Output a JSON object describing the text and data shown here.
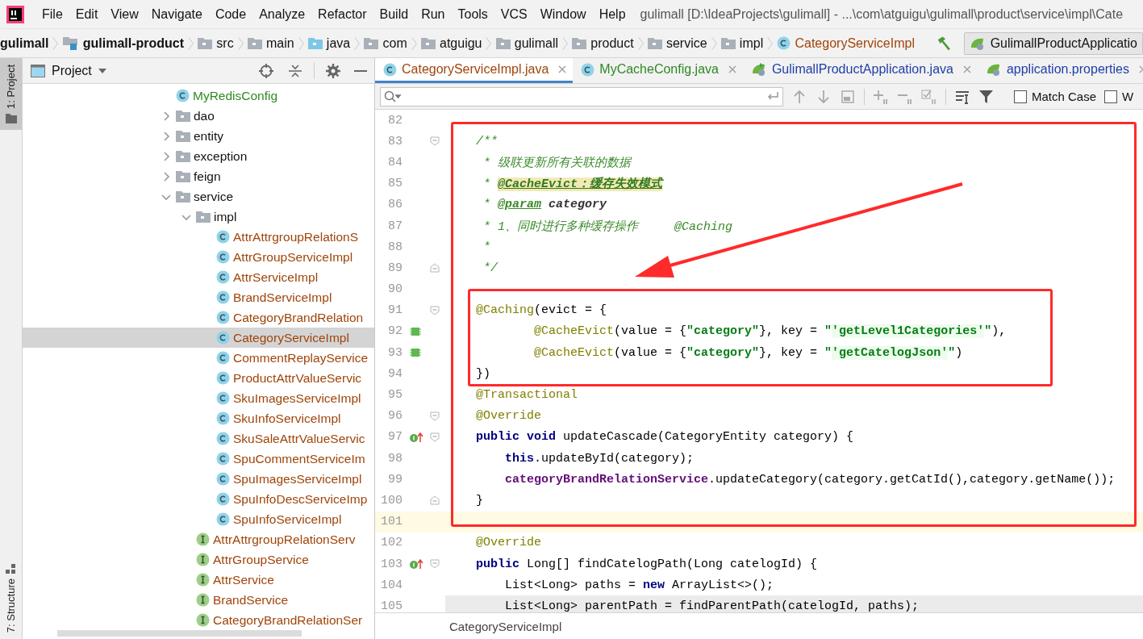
{
  "menu": [
    "File",
    "Edit",
    "View",
    "Navigate",
    "Code",
    "Analyze",
    "Refactor",
    "Build",
    "Run",
    "Tools",
    "VCS",
    "Window",
    "Help"
  ],
  "window": {
    "title": "gulimall [D:\\IdeaProjects\\gulimall] - ...\\com\\atguigu\\gulimall\\product\\service\\impl\\Cate"
  },
  "breadcrumbs": [
    {
      "label": "gulimall",
      "kind": "project"
    },
    {
      "label": "gulimall-product",
      "kind": "module"
    },
    {
      "label": "src",
      "kind": "folder"
    },
    {
      "label": "main",
      "kind": "folder"
    },
    {
      "label": "java",
      "kind": "source"
    },
    {
      "label": "com",
      "kind": "package"
    },
    {
      "label": "atguigu",
      "kind": "package"
    },
    {
      "label": "gulimall",
      "kind": "package"
    },
    {
      "label": "product",
      "kind": "package"
    },
    {
      "label": "service",
      "kind": "package"
    },
    {
      "label": "impl",
      "kind": "package"
    },
    {
      "label": "CategoryServiceImpl",
      "kind": "class"
    }
  ],
  "run_config": {
    "label": "GulimallProductApplicatio"
  },
  "tool_strip": [
    {
      "label": "1: Project",
      "selected": true,
      "kind": "project"
    },
    {
      "label": "7: Structure",
      "selected": false,
      "kind": "structure"
    }
  ],
  "project_panel": {
    "title": "Project",
    "tree": [
      {
        "label": "MyRedisConfig",
        "kind": "class",
        "color": "#2f8a22",
        "selected": false
      },
      {
        "label": "dao",
        "kind": "package",
        "expanded": false,
        "selected": false
      },
      {
        "label": "entity",
        "kind": "package",
        "expanded": false,
        "selected": false
      },
      {
        "label": "exception",
        "kind": "package",
        "expanded": false,
        "selected": false
      },
      {
        "label": "feign",
        "kind": "package",
        "expanded": false,
        "selected": false
      },
      {
        "label": "service",
        "kind": "package",
        "expanded": true,
        "selected": false,
        "children": [
          {
            "label": "impl",
            "kind": "package",
            "expanded": true,
            "selected": false,
            "children": [
              {
                "label": "AttrAttrgroupRelationS",
                "kind": "class",
                "color": "#a0450a",
                "selected": false
              },
              {
                "label": "AttrGroupServiceImpl",
                "kind": "class",
                "color": "#a0450a",
                "selected": false
              },
              {
                "label": "AttrServiceImpl",
                "kind": "class",
                "color": "#a0450a",
                "selected": false
              },
              {
                "label": "BrandServiceImpl",
                "kind": "class",
                "color": "#a0450a",
                "selected": false
              },
              {
                "label": "CategoryBrandRelation",
                "kind": "class",
                "color": "#a0450a",
                "selected": false
              },
              {
                "label": "CategoryServiceImpl",
                "kind": "class",
                "color": "#a0450a",
                "selected": true
              },
              {
                "label": "CommentReplayService",
                "kind": "class",
                "color": "#a0450a",
                "selected": false
              },
              {
                "label": "ProductAttrValueServic",
                "kind": "class",
                "color": "#a0450a",
                "selected": false
              },
              {
                "label": "SkuImagesServiceImpl",
                "kind": "class",
                "color": "#a0450a",
                "selected": false
              },
              {
                "label": "SkuInfoServiceImpl",
                "kind": "class",
                "color": "#a0450a",
                "selected": false
              },
              {
                "label": "SkuSaleAttrValueServic",
                "kind": "class",
                "color": "#a0450a",
                "selected": false
              },
              {
                "label": "SpuCommentServiceIm",
                "kind": "class",
                "color": "#a0450a",
                "selected": false
              },
              {
                "label": "SpuImagesServiceImpl",
                "kind": "class",
                "color": "#a0450a",
                "selected": false
              },
              {
                "label": "SpuInfoDescServiceImp",
                "kind": "class",
                "color": "#a0450a",
                "selected": false
              },
              {
                "label": "SpuInfoServiceImpl",
                "kind": "class",
                "color": "#a0450a",
                "selected": false
              }
            ]
          },
          {
            "label": "AttrAttrgroupRelationServ",
            "kind": "interface",
            "color": "#a0450a",
            "selected": false
          },
          {
            "label": "AttrGroupService",
            "kind": "interface",
            "color": "#a0450a",
            "selected": false
          },
          {
            "label": "AttrService",
            "kind": "interface",
            "color": "#a0450a",
            "selected": false
          },
          {
            "label": "BrandService",
            "kind": "interface",
            "color": "#a0450a",
            "selected": false
          },
          {
            "label": "CategoryBrandRelationSer",
            "kind": "interface",
            "color": "#a0450a",
            "selected": false
          }
        ]
      }
    ]
  },
  "tabs": [
    {
      "label": "CategoryServiceImpl.java",
      "kind": "class",
      "color": "#a0450a",
      "selected": true
    },
    {
      "label": "MyCacheConfig.java",
      "kind": "class",
      "color": "#2f8a22",
      "selected": false
    },
    {
      "label": "GulimallProductApplication.java",
      "kind": "app",
      "color": "#1f3fa8",
      "selected": false
    },
    {
      "label": "application.properties",
      "kind": "properties",
      "color": "#1f3fa8",
      "selected": false
    }
  ],
  "find_bar": {
    "options": [
      {
        "label": "Match Case",
        "checked": false
      },
      {
        "label": "W",
        "checked": false
      }
    ]
  },
  "code": {
    "lines": [
      {
        "number": "82"
      },
      {
        "number": "83",
        "fold_start": true,
        "tokens": [
          {
            "text": "    /**",
            "kind": "comment"
          }
        ]
      },
      {
        "number": "84",
        "tokens": [
          {
            "text": "     * 级联更新所有关联的数据",
            "kind": "comment"
          }
        ]
      },
      {
        "number": "85",
        "tokens": [
          {
            "text": "     * ",
            "kind": "comment"
          },
          {
            "text": "@CacheEvict：缓存失效模式",
            "kind": "doctag-marked"
          }
        ]
      },
      {
        "number": "86",
        "tokens": [
          {
            "text": "     * ",
            "kind": "comment"
          },
          {
            "text": "@param",
            "kind": "doctag"
          },
          {
            "text": " category",
            "kind": "param"
          }
        ]
      },
      {
        "number": "87",
        "tokens": [
          {
            "text": "     * 1、同时进行多种缓存操作     @Caching",
            "kind": "comment"
          }
        ]
      },
      {
        "number": "88",
        "tokens": [
          {
            "text": "     *",
            "kind": "comment"
          }
        ]
      },
      {
        "number": "89",
        "fold_end": true,
        "tokens": [
          {
            "text": "     */",
            "kind": "comment"
          }
        ]
      },
      {
        "number": "90"
      },
      {
        "number": "91",
        "fold_start": true,
        "tokens": [
          {
            "text": "    @Caching",
            "kind": "annotation"
          },
          {
            "text": "(evict = {",
            "kind": "plain"
          }
        ]
      },
      {
        "number": "92",
        "bean": true,
        "tokens": [
          {
            "text": "            @CacheEvict",
            "kind": "annotation"
          },
          {
            "text": "(value = {",
            "kind": "plain"
          },
          {
            "text": "\"category\"",
            "kind": "string"
          },
          {
            "text": "}, key = ",
            "kind": "plain"
          },
          {
            "text": "\"",
            "kind": "string"
          },
          {
            "text": "'getLevel1Categories'",
            "kind": "injected"
          },
          {
            "text": "\"",
            "kind": "string"
          },
          {
            "text": "),",
            "kind": "plain"
          }
        ]
      },
      {
        "number": "93",
        "bean": true,
        "tokens": [
          {
            "text": "            @CacheEvict",
            "kind": "annotation"
          },
          {
            "text": "(value = {",
            "kind": "plain"
          },
          {
            "text": "\"category\"",
            "kind": "string"
          },
          {
            "text": "}, key = ",
            "kind": "plain"
          },
          {
            "text": "\"",
            "kind": "string"
          },
          {
            "text": "'getCatelogJson'",
            "kind": "injected"
          },
          {
            "text": "\"",
            "kind": "string"
          },
          {
            "text": ")",
            "kind": "plain"
          }
        ]
      },
      {
        "number": "94",
        "tokens": [
          {
            "text": "    })",
            "kind": "plain"
          }
        ]
      },
      {
        "number": "95",
        "tokens": [
          {
            "text": "    @Transactional",
            "kind": "annotation"
          }
        ]
      },
      {
        "number": "96",
        "fold_start": true,
        "tokens": [
          {
            "text": "    @Override",
            "kind": "annotation"
          }
        ]
      },
      {
        "number": "97",
        "implements": true,
        "fold_start": true,
        "tokens": [
          {
            "text": "    public",
            "kind": "keyword"
          },
          {
            "text": " void",
            "kind": "keyword"
          },
          {
            "text": " updateCascade(CategoryEntity category) {",
            "kind": "plain"
          }
        ]
      },
      {
        "number": "98",
        "tokens": [
          {
            "text": "        this",
            "kind": "keyword"
          },
          {
            "text": ".updateById(category);",
            "kind": "plain"
          }
        ]
      },
      {
        "number": "99",
        "tokens": [
          {
            "text": "        categoryBrandRelationService",
            "kind": "field"
          },
          {
            "text": ".updateCategory(category.getCatId(),category.getName());",
            "kind": "plain"
          }
        ]
      },
      {
        "number": "100",
        "fold_end": true,
        "tokens": [
          {
            "text": "    }",
            "kind": "plain"
          }
        ]
      },
      {
        "number": "101",
        "caret_line": true
      },
      {
        "number": "102",
        "tokens": [
          {
            "text": "    @Override",
            "kind": "annotation"
          }
        ]
      },
      {
        "number": "103",
        "implements": true,
        "fold_start": true,
        "tokens": [
          {
            "text": "    public",
            "kind": "keyword"
          },
          {
            "text": " Long[] findCatelogPath(Long catelogId) {",
            "kind": "plain"
          }
        ]
      },
      {
        "number": "104",
        "tokens": [
          {
            "text": "        List<Long> paths = ",
            "kind": "plain"
          },
          {
            "text": "new",
            "kind": "keyword"
          },
          {
            "text": " ArrayList<>();",
            "kind": "plain"
          }
        ]
      },
      {
        "number": "105",
        "shaded": true,
        "tokens": [
          {
            "text": "        List<Long> parentPath = findParentPath(catelogId, paths);",
            "kind": "plain"
          }
        ]
      }
    ]
  },
  "editor_breadcrumb": {
    "label": "CategoryServiceImpl"
  }
}
